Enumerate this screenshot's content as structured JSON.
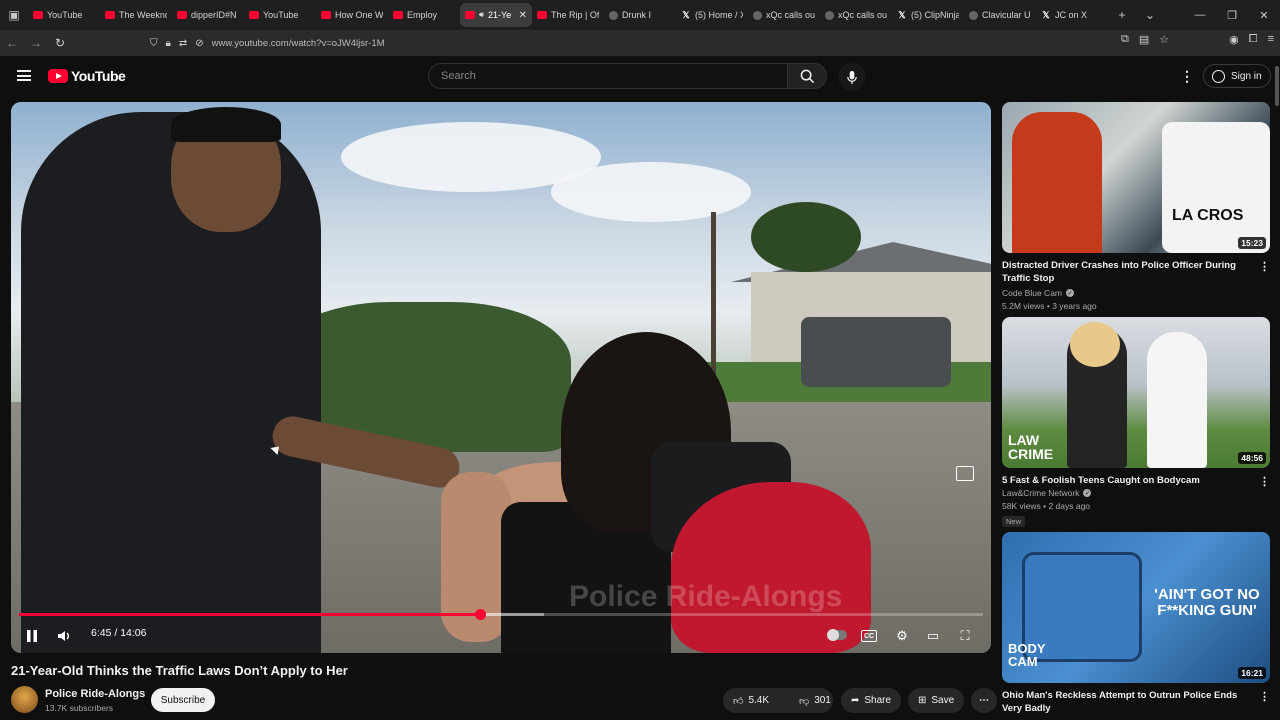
{
  "browser": {
    "tabs": [
      {
        "label": "YouTube",
        "favicon": "yt"
      },
      {
        "label": "The Weeknd",
        "favicon": "yt"
      },
      {
        "label": "dipperID#N",
        "favicon": "yt"
      },
      {
        "label": "YouTube",
        "favicon": "yt"
      },
      {
        "label": "How One W",
        "favicon": "yt"
      },
      {
        "label": "Employ",
        "favicon": "yt"
      },
      {
        "label": "21-Ye",
        "favicon": "yt",
        "active": true
      },
      {
        "label": "The Rip | Of",
        "favicon": "yt"
      },
      {
        "label": "Drunk I",
        "favicon": "gen"
      },
      {
        "label": "(5) Home / X",
        "favicon": "x"
      },
      {
        "label": "xQc calls ou",
        "favicon": "gen"
      },
      {
        "label": "xQc calls ou",
        "favicon": "gen"
      },
      {
        "label": "(5) ClipNinja",
        "favicon": "x"
      },
      {
        "label": "Clavicular U",
        "favicon": "gen"
      },
      {
        "label": "JC on X",
        "favicon": "x"
      }
    ],
    "url": "www.youtube.com/watch?v=oJW4ljsr-1M"
  },
  "header": {
    "logo_text": "YouTube",
    "search_placeholder": "Search",
    "signin_label": "Sign in"
  },
  "player": {
    "watermark": "Police Ride-Alongs",
    "time": "6:45 / 14:06",
    "progress": 0.478,
    "buffered": 0.545
  },
  "video": {
    "title": "21-Year-Old Thinks the Traffic Laws Don’t Apply to Her",
    "channel": "Police Ride-Alongs",
    "subscribers": "13.7K subscribers",
    "subscribe_label": "Subscribe",
    "likes": "5.4K",
    "dislikes": "301",
    "share_label": "Share",
    "save_label": "Save"
  },
  "recommendations": [
    {
      "title": "Distracted Driver Crashes into Police Officer During Traffic Stop",
      "channel": "Code Blue Cam",
      "meta": "5.2M views • 3 years ago",
      "duration": "15:23",
      "badge": "",
      "thumb_text": "LA CROS"
    },
    {
      "title": "5 Fast & Foolish Teens Caught on Bodycam",
      "channel": "Law&Crime Network",
      "meta": "58K views • 2 days ago",
      "duration": "48:56",
      "badge": "New",
      "thumb_text": "LAW CRIME"
    },
    {
      "title": "Ohio Man's Reckless Attempt to Outrun Police Ends Very Badly",
      "channel": "",
      "meta": "",
      "duration": "16:21",
      "badge": "",
      "thumb_text": "'AIN'T GOT NO F**KING GUN'",
      "thumb_sub": "BODY CAM"
    }
  ]
}
